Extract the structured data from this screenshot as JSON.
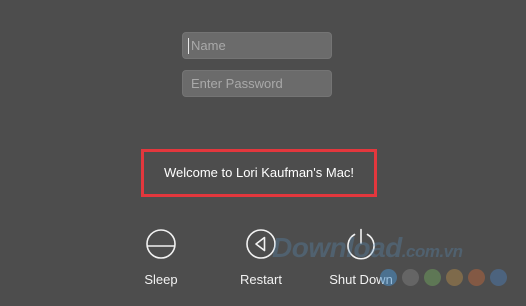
{
  "login": {
    "name_placeholder": "Name",
    "password_placeholder": "Enter Password"
  },
  "message": {
    "text": "Welcome to Lori Kaufman's Mac!",
    "highlight_color": "#e3373d"
  },
  "actions": [
    {
      "label": "Sleep",
      "icon": "sleep-icon"
    },
    {
      "label": "Restart",
      "icon": "restart-icon"
    },
    {
      "label": "Shut Down",
      "icon": "power-icon"
    }
  ],
  "watermark": {
    "main": "Download",
    "suffix": ".com.vn",
    "dot_colors": [
      "#4a8fc8",
      "#7a7a7a",
      "#6e9a5c",
      "#a8844a",
      "#b0653e",
      "#4d77a8"
    ]
  }
}
